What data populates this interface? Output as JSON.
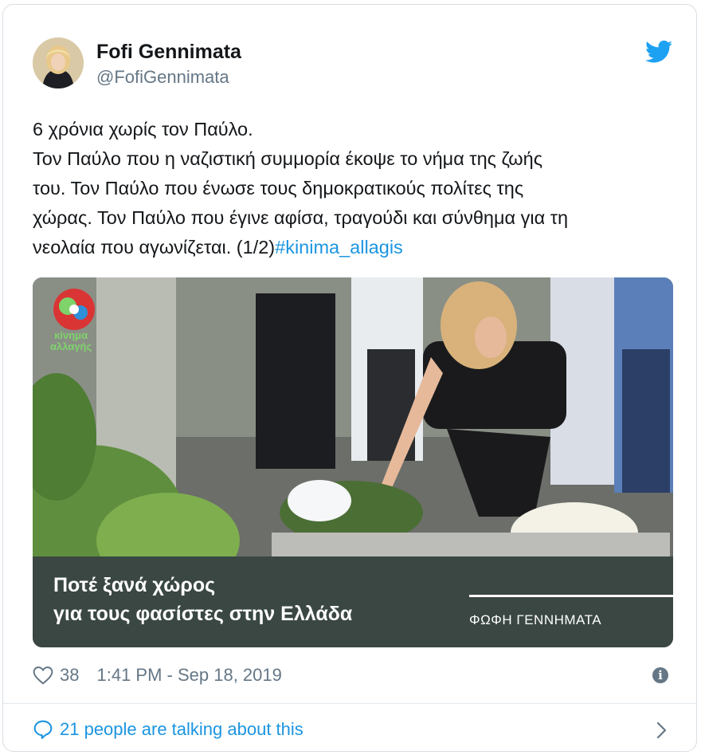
{
  "author": {
    "name": "Fofi Gennimata",
    "handle": "@FofiGennimata"
  },
  "tweet": {
    "lines": [
      "6 χρόνια χωρίς τον Παύλο.",
      "Τον Παύλο που η ναζιστική συμμορία έκοψε το νήμα της ζωής",
      "του. Τον Παύλο που ένωσε τους δημοκρατικούς πολίτες της",
      "χώρας. Τον Παύλο που έγινε αφίσα, τραγούδι και σύνθημα για τη",
      "νεολαία που αγωνίζεται. (1/2)"
    ],
    "hashtag": "#kinima_allagis"
  },
  "media": {
    "logo_line1": "κίνημα",
    "logo_line2": "αλλαγής",
    "slogan_line1": "Ποτέ ξανά χώρος",
    "slogan_line2": "για τους φασίστες στην Ελλάδα",
    "signature": "ΦΩΦΗ ΓΕΝΝΗΜΑΤΑ"
  },
  "footer": {
    "likes": "38",
    "timestamp": "1:41 PM - Sep 18, 2019",
    "info_icon": "info-icon",
    "heart_icon": "heart-icon"
  },
  "conversation": {
    "label": "21 people are talking about this",
    "icon": "speech-bubble-icon"
  },
  "colors": {
    "link": "#1b95e0",
    "muted": "#657786",
    "banner": "#3a4742",
    "twitter_blue": "#1da1f2"
  }
}
